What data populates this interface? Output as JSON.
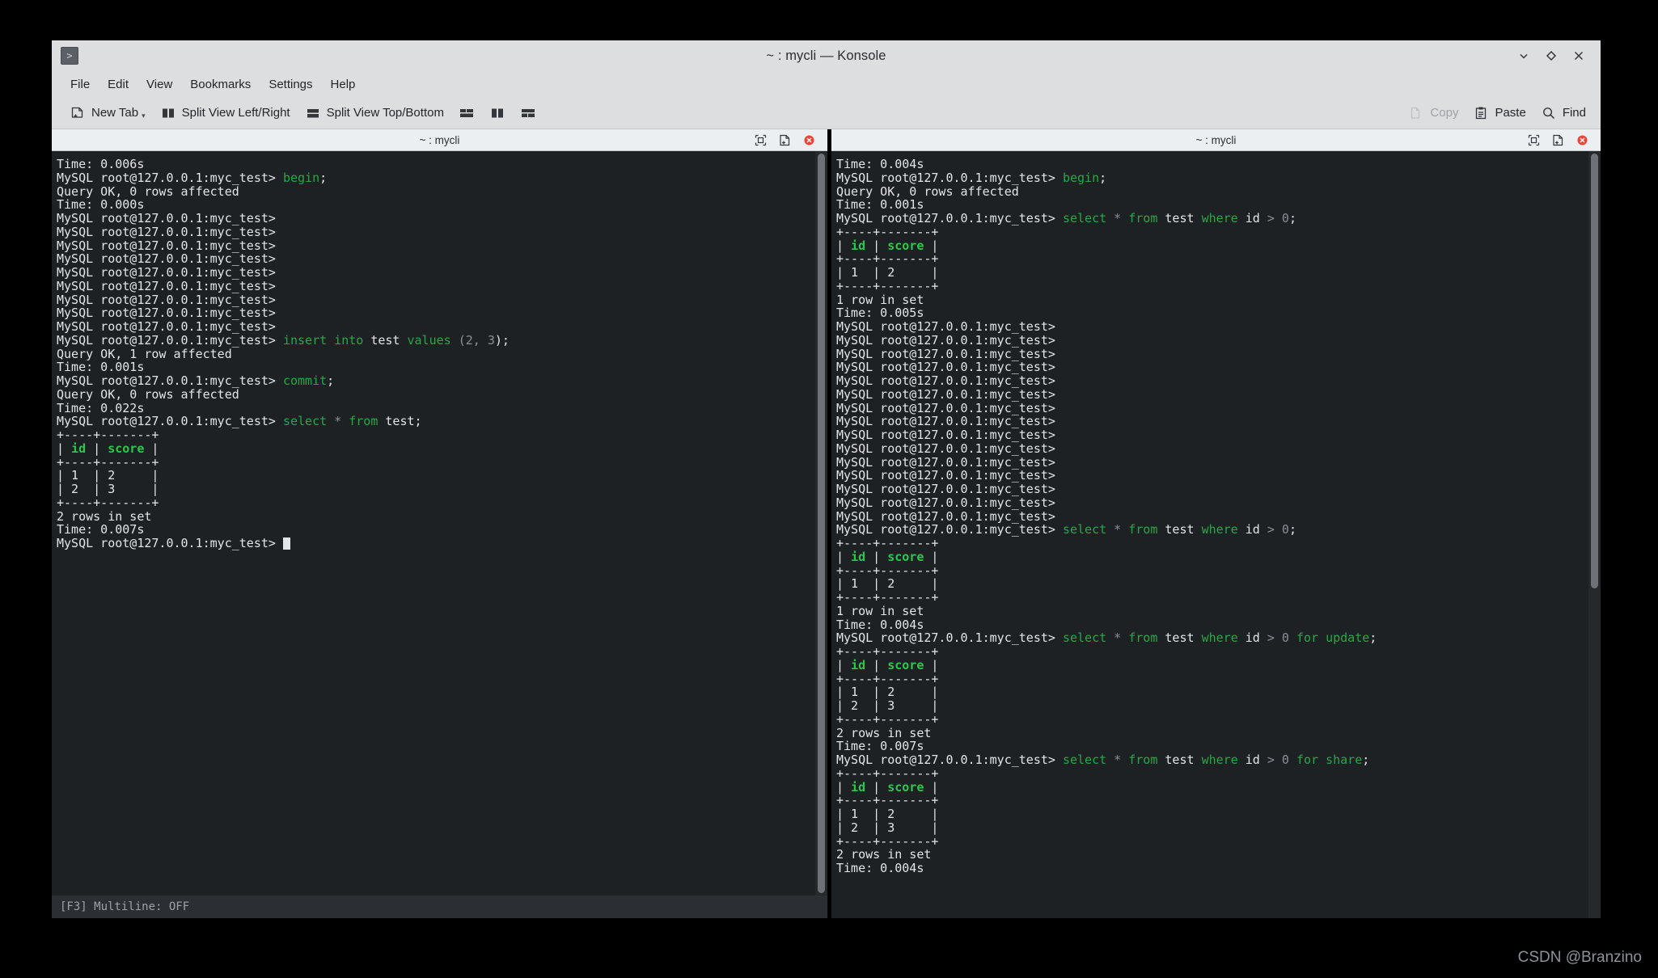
{
  "window": {
    "title": "~ : mycli — Konsole",
    "app_icon": "terminal-prompt-icon",
    "controls": [
      {
        "name": "minimize-button",
        "icon": "chevron-down-icon"
      },
      {
        "name": "maximize-button",
        "icon": "diamond-icon"
      },
      {
        "name": "close-button",
        "icon": "close-x-icon"
      }
    ]
  },
  "menubar": {
    "items": [
      {
        "label": "File"
      },
      {
        "label": "Edit"
      },
      {
        "label": "View"
      },
      {
        "label": "Bookmarks"
      },
      {
        "label": "Settings"
      },
      {
        "label": "Help"
      }
    ]
  },
  "toolbar": {
    "new_tab": "New Tab",
    "split_left_right": "Split View Left/Right",
    "split_top_bottom": "Split View Top/Bottom",
    "copy": "Copy",
    "paste": "Paste",
    "find": "Find",
    "copy_disabled": true
  },
  "panes": {
    "left": {
      "tab_title": "~ : mycli",
      "status": "[F3] Multiline: OFF",
      "lines": [
        [
          {
            "t": "Time: 0.006s"
          }
        ],
        [
          {
            "t": "MySQL root@127.0.0.1:myc_test> "
          },
          {
            "t": "begin",
            "c": "kw"
          },
          {
            "t": ";"
          }
        ],
        [
          {
            "t": "Query OK, 0 rows affected"
          }
        ],
        [
          {
            "t": "Time: 0.000s"
          }
        ],
        [
          {
            "t": "MySQL root@127.0.0.1:myc_test>"
          }
        ],
        [
          {
            "t": "MySQL root@127.0.0.1:myc_test>"
          }
        ],
        [
          {
            "t": "MySQL root@127.0.0.1:myc_test>"
          }
        ],
        [
          {
            "t": "MySQL root@127.0.0.1:myc_test>"
          }
        ],
        [
          {
            "t": "MySQL root@127.0.0.1:myc_test>"
          }
        ],
        [
          {
            "t": "MySQL root@127.0.0.1:myc_test>"
          }
        ],
        [
          {
            "t": "MySQL root@127.0.0.1:myc_test>"
          }
        ],
        [
          {
            "t": "MySQL root@127.0.0.1:myc_test>"
          }
        ],
        [
          {
            "t": "MySQL root@127.0.0.1:myc_test>"
          }
        ],
        [
          {
            "t": "MySQL root@127.0.0.1:myc_test> "
          },
          {
            "t": "insert into",
            "c": "kw"
          },
          {
            "t": " test "
          },
          {
            "t": "values",
            "c": "kw"
          },
          {
            "t": " (",
            "c": "op"
          },
          {
            "t": "2",
            "c": "num"
          },
          {
            "t": ", ",
            "c": "op"
          },
          {
            "t": "3",
            "c": "num"
          },
          {
            "t": ");"
          }
        ],
        [
          {
            "t": "Query OK, 1 row affected"
          }
        ],
        [
          {
            "t": "Time: 0.001s"
          }
        ],
        [
          {
            "t": "MySQL root@127.0.0.1:myc_test> "
          },
          {
            "t": "commit",
            "c": "kw"
          },
          {
            "t": ";"
          }
        ],
        [
          {
            "t": "Query OK, 0 rows affected"
          }
        ],
        [
          {
            "t": "Time: 0.022s"
          }
        ],
        [
          {
            "t": "MySQL root@127.0.0.1:myc_test> "
          },
          {
            "t": "select",
            "c": "kw"
          },
          {
            "t": " * ",
            "c": "op"
          },
          {
            "t": "from",
            "c": "kw"
          },
          {
            "t": " test;"
          }
        ],
        [
          {
            "t": "+----+-------+"
          }
        ],
        [
          {
            "t": "| "
          },
          {
            "t": "id",
            "c": "hdr"
          },
          {
            "t": " | "
          },
          {
            "t": "score",
            "c": "hdr"
          },
          {
            "t": " |"
          }
        ],
        [
          {
            "t": "+----+-------+"
          }
        ],
        [
          {
            "t": "| 1  | 2     |"
          }
        ],
        [
          {
            "t": "| 2  | 3     |"
          }
        ],
        [
          {
            "t": "+----+-------+"
          }
        ],
        [
          {
            "t": "2 rows in set"
          }
        ],
        [
          {
            "t": "Time: 0.007s"
          }
        ],
        [
          {
            "t": "MySQL root@127.0.0.1:myc_test> "
          },
          {
            "t": "",
            "c": "cursor"
          }
        ]
      ]
    },
    "right": {
      "tab_title": "~ : mycli",
      "lines": [
        [
          {
            "t": "Time: 0.004s"
          }
        ],
        [
          {
            "t": "MySQL root@127.0.0.1:myc_test> "
          },
          {
            "t": "begin",
            "c": "kw"
          },
          {
            "t": ";"
          }
        ],
        [
          {
            "t": "Query OK, 0 rows affected"
          }
        ],
        [
          {
            "t": "Time: 0.001s"
          }
        ],
        [
          {
            "t": "MySQL root@127.0.0.1:myc_test> "
          },
          {
            "t": "select",
            "c": "kw"
          },
          {
            "t": " * ",
            "c": "op"
          },
          {
            "t": "from",
            "c": "kw"
          },
          {
            "t": " test "
          },
          {
            "t": "where",
            "c": "kw"
          },
          {
            "t": " id "
          },
          {
            "t": "> ",
            "c": "op"
          },
          {
            "t": "0",
            "c": "num"
          },
          {
            "t": ";"
          }
        ],
        [
          {
            "t": "+----+-------+"
          }
        ],
        [
          {
            "t": "| "
          },
          {
            "t": "id",
            "c": "hdr"
          },
          {
            "t": " | "
          },
          {
            "t": "score",
            "c": "hdr"
          },
          {
            "t": " |"
          }
        ],
        [
          {
            "t": "+----+-------+"
          }
        ],
        [
          {
            "t": "| 1  | 2     |"
          }
        ],
        [
          {
            "t": "+----+-------+"
          }
        ],
        [
          {
            "t": "1 row in set"
          }
        ],
        [
          {
            "t": "Time: 0.005s"
          }
        ],
        [
          {
            "t": "MySQL root@127.0.0.1:myc_test>"
          }
        ],
        [
          {
            "t": "MySQL root@127.0.0.1:myc_test>"
          }
        ],
        [
          {
            "t": "MySQL root@127.0.0.1:myc_test>"
          }
        ],
        [
          {
            "t": "MySQL root@127.0.0.1:myc_test>"
          }
        ],
        [
          {
            "t": "MySQL root@127.0.0.1:myc_test>"
          }
        ],
        [
          {
            "t": "MySQL root@127.0.0.1:myc_test>"
          }
        ],
        [
          {
            "t": "MySQL root@127.0.0.1:myc_test>"
          }
        ],
        [
          {
            "t": "MySQL root@127.0.0.1:myc_test>"
          }
        ],
        [
          {
            "t": "MySQL root@127.0.0.1:myc_test>"
          }
        ],
        [
          {
            "t": "MySQL root@127.0.0.1:myc_test>"
          }
        ],
        [
          {
            "t": "MySQL root@127.0.0.1:myc_test>"
          }
        ],
        [
          {
            "t": "MySQL root@127.0.0.1:myc_test>"
          }
        ],
        [
          {
            "t": "MySQL root@127.0.0.1:myc_test>"
          }
        ],
        [
          {
            "t": "MySQL root@127.0.0.1:myc_test>"
          }
        ],
        [
          {
            "t": "MySQL root@127.0.0.1:myc_test>"
          }
        ],
        [
          {
            "t": "MySQL root@127.0.0.1:myc_test> "
          },
          {
            "t": "select",
            "c": "kw"
          },
          {
            "t": " * ",
            "c": "op"
          },
          {
            "t": "from",
            "c": "kw"
          },
          {
            "t": " test "
          },
          {
            "t": "where",
            "c": "kw"
          },
          {
            "t": " id "
          },
          {
            "t": "> ",
            "c": "op"
          },
          {
            "t": "0",
            "c": "num"
          },
          {
            "t": ";"
          }
        ],
        [
          {
            "t": "+----+-------+"
          }
        ],
        [
          {
            "t": "| "
          },
          {
            "t": "id",
            "c": "hdr"
          },
          {
            "t": " | "
          },
          {
            "t": "score",
            "c": "hdr"
          },
          {
            "t": " |"
          }
        ],
        [
          {
            "t": "+----+-------+"
          }
        ],
        [
          {
            "t": "| 1  | 2     |"
          }
        ],
        [
          {
            "t": "+----+-------+"
          }
        ],
        [
          {
            "t": "1 row in set"
          }
        ],
        [
          {
            "t": "Time: 0.004s"
          }
        ],
        [
          {
            "t": "MySQL root@127.0.0.1:myc_test> "
          },
          {
            "t": "select",
            "c": "kw"
          },
          {
            "t": " * ",
            "c": "op"
          },
          {
            "t": "from",
            "c": "kw"
          },
          {
            "t": " test "
          },
          {
            "t": "where",
            "c": "kw"
          },
          {
            "t": " id "
          },
          {
            "t": "> ",
            "c": "op"
          },
          {
            "t": "0",
            "c": "num"
          },
          {
            "t": " "
          },
          {
            "t": "for update",
            "c": "kw"
          },
          {
            "t": ";"
          }
        ],
        [
          {
            "t": "+----+-------+"
          }
        ],
        [
          {
            "t": "| "
          },
          {
            "t": "id",
            "c": "hdr"
          },
          {
            "t": " | "
          },
          {
            "t": "score",
            "c": "hdr"
          },
          {
            "t": " |"
          }
        ],
        [
          {
            "t": "+----+-------+"
          }
        ],
        [
          {
            "t": "| 1  | 2     |"
          }
        ],
        [
          {
            "t": "| 2  | 3     |"
          }
        ],
        [
          {
            "t": "+----+-------+"
          }
        ],
        [
          {
            "t": "2 rows in set"
          }
        ],
        [
          {
            "t": "Time: 0.007s"
          }
        ],
        [
          {
            "t": "MySQL root@127.0.0.1:myc_test> "
          },
          {
            "t": "select",
            "c": "kw"
          },
          {
            "t": " * ",
            "c": "op"
          },
          {
            "t": "from",
            "c": "kw"
          },
          {
            "t": " test "
          },
          {
            "t": "where",
            "c": "kw"
          },
          {
            "t": " id "
          },
          {
            "t": "> ",
            "c": "op"
          },
          {
            "t": "0",
            "c": "num"
          },
          {
            "t": " "
          },
          {
            "t": "for share",
            "c": "kw"
          },
          {
            "t": ";"
          }
        ],
        [
          {
            "t": "+----+-------+"
          }
        ],
        [
          {
            "t": "| "
          },
          {
            "t": "id",
            "c": "hdr"
          },
          {
            "t": " | "
          },
          {
            "t": "score",
            "c": "hdr"
          },
          {
            "t": " |"
          }
        ],
        [
          {
            "t": "+----+-------+"
          }
        ],
        [
          {
            "t": "| 1  | 2     |"
          }
        ],
        [
          {
            "t": "| 2  | 3     |"
          }
        ],
        [
          {
            "t": "+----+-------+"
          }
        ],
        [
          {
            "t": "2 rows in set"
          }
        ],
        [
          {
            "t": "Time: 0.004s"
          }
        ]
      ]
    }
  },
  "watermark": "CSDN @Branzino",
  "colors": {
    "terminal_bg": "#1e2124",
    "keyword_green": "#28a745",
    "header_green": "#2bc84a",
    "chrome": "#dcdee0",
    "close_red": "#e8453c"
  }
}
